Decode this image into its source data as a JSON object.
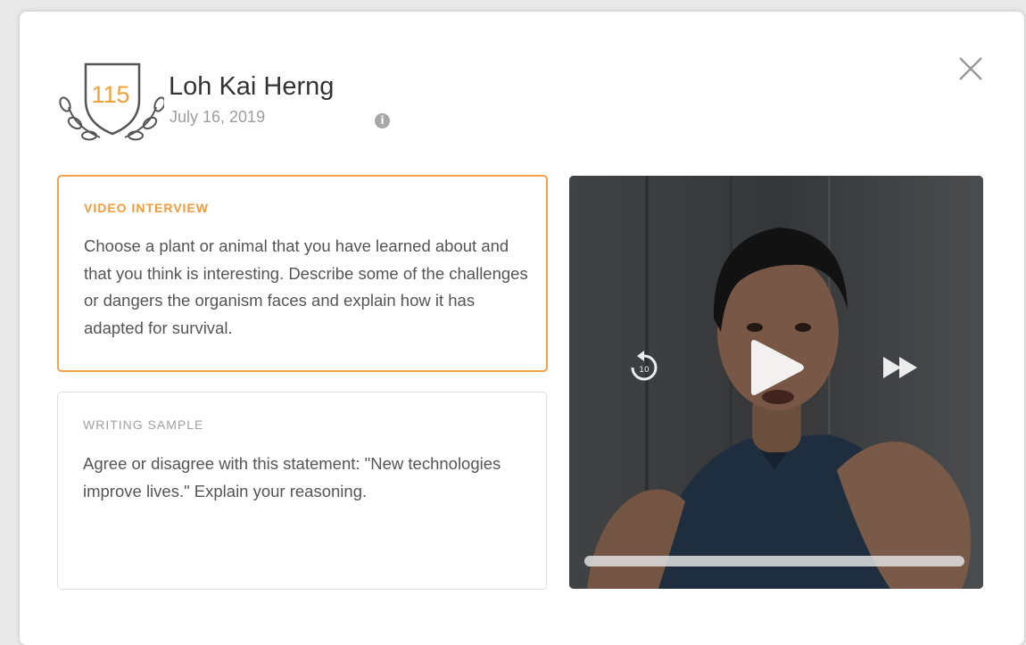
{
  "candidate": {
    "score": "115",
    "name": "Loh Kai Herng",
    "date": "July 16, 2019"
  },
  "icons": {
    "badge": "laurel-badge-icon",
    "info": "info-icon",
    "close": "close-icon",
    "replay": "replay-10-icon",
    "play": "play-icon",
    "fast_forward": "fast-forward-icon"
  },
  "colors": {
    "accent": "#f39a3c",
    "score": "#f0a33a",
    "inactive_border": "#dedede"
  },
  "prompts": [
    {
      "label": "VIDEO INTERVIEW",
      "text": "Choose a plant or animal that you have learned about and that you think is interesting. Describe some of the challenges or dangers the organism faces and explain how it has adapted for survival.",
      "selected": true
    },
    {
      "label": "WRITING SAMPLE",
      "text": "Agree or disagree with this statement: \"New technologies improve lives.\" Explain your reasoning.",
      "selected": false
    }
  ],
  "video": {
    "replay_seconds": "10",
    "progress": 0.0
  }
}
